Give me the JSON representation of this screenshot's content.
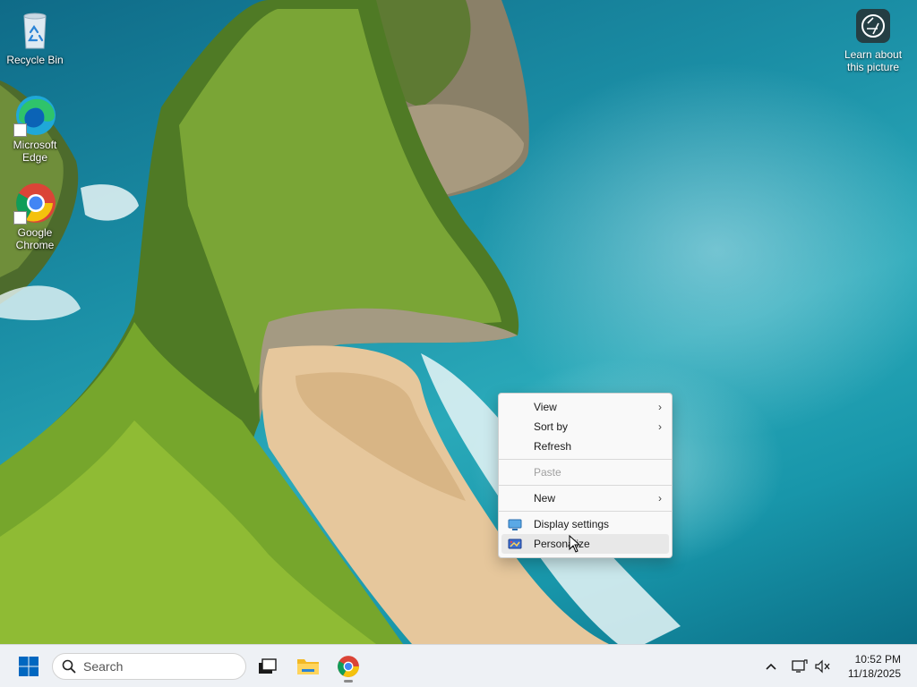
{
  "desktop": {
    "icons": [
      {
        "label": "Recycle Bin",
        "icon": "recycle-bin-icon"
      },
      {
        "label": "Microsoft Edge",
        "icon": "edge-icon"
      },
      {
        "label": "Google Chrome",
        "icon": "chrome-icon"
      }
    ],
    "learn_picture": {
      "label": "Learn about this picture",
      "icon": "camera-icon"
    }
  },
  "context_menu": {
    "items": [
      {
        "label": "View",
        "submenu": true
      },
      {
        "label": "Sort by",
        "submenu": true
      },
      {
        "label": "Refresh"
      },
      {
        "label": "Paste",
        "disabled": true
      },
      {
        "label": "New",
        "submenu": true
      },
      {
        "label": "Display settings",
        "icon": "display-settings-icon"
      },
      {
        "label": "Personalize",
        "icon": "personalize-icon"
      }
    ],
    "chevron": "›"
  },
  "taskbar": {
    "start_icon": "windows-logo-icon",
    "search": {
      "placeholder": "Search",
      "icon": "search-icon"
    },
    "apps": [
      {
        "name": "Task View",
        "icon": "task-view-icon"
      },
      {
        "name": "File Explorer",
        "icon": "folder-icon"
      },
      {
        "name": "Google Chrome",
        "icon": "chrome-icon",
        "running": true
      }
    ],
    "tray": {
      "chevron": "^",
      "icons": [
        "network-icon",
        "volume-muted-icon"
      ]
    },
    "clock": {
      "time": "10:52 PM",
      "date": "11/18/2025"
    }
  },
  "colors": {
    "windows_blue": "#0067c0",
    "taskbar_bg": "#eef1f5",
    "menu_bg": "#f9f9f9",
    "ocean": "#1896aa",
    "cliff_green": "#6a9a2a",
    "sand": "#e6c79c"
  }
}
